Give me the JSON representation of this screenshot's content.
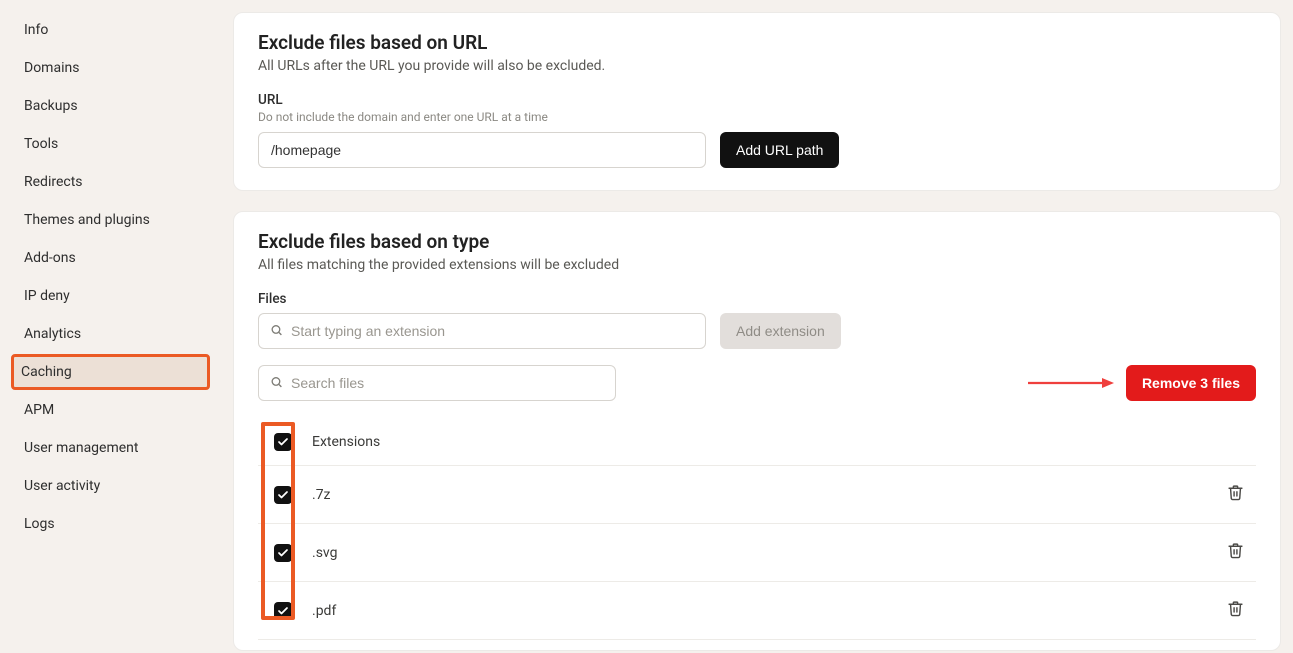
{
  "sidebar": {
    "items": [
      {
        "label": "Info"
      },
      {
        "label": "Domains"
      },
      {
        "label": "Backups"
      },
      {
        "label": "Tools"
      },
      {
        "label": "Redirects"
      },
      {
        "label": "Themes and plugins"
      },
      {
        "label": "Add-ons"
      },
      {
        "label": "IP deny"
      },
      {
        "label": "Analytics"
      },
      {
        "label": "Caching",
        "active": true
      },
      {
        "label": "APM"
      },
      {
        "label": "User management"
      },
      {
        "label": "User activity"
      },
      {
        "label": "Logs"
      }
    ]
  },
  "url_section": {
    "title": "Exclude files based on URL",
    "description": "All URLs after the URL you provide will also be excluded.",
    "field_label": "URL",
    "field_help": "Do not include the domain and enter one URL at a time",
    "input_value": "/homepage",
    "button_label": "Add URL path"
  },
  "type_section": {
    "title": "Exclude files based on type",
    "description": "All files matching the provided extensions will be excluded",
    "field_label": "Files",
    "ext_placeholder": "Start typing an extension",
    "add_ext_label": "Add extension",
    "search_placeholder": "Search files",
    "remove_button_label": "Remove 3 files",
    "header_label": "Extensions",
    "rows": [
      {
        "ext": ".7z",
        "checked": true
      },
      {
        "ext": ".svg",
        "checked": true
      },
      {
        "ext": ".pdf",
        "checked": true
      }
    ]
  }
}
